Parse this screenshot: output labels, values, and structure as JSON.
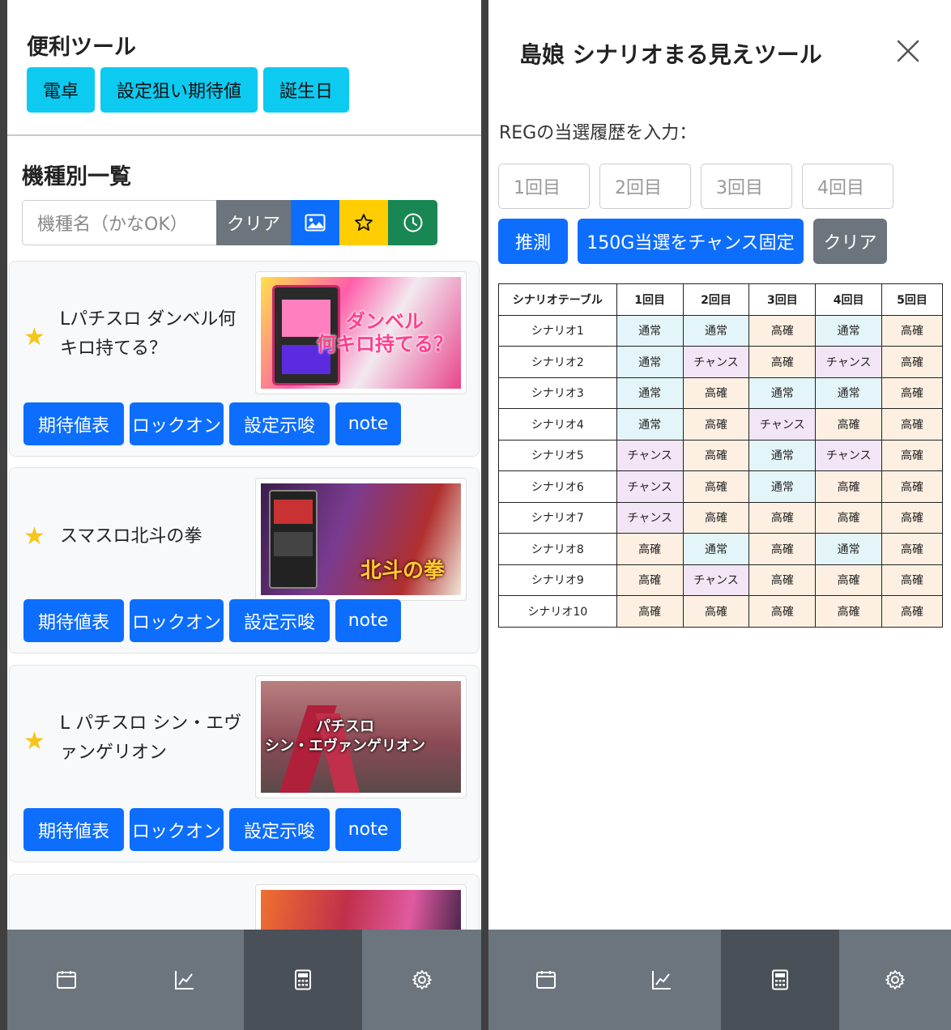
{
  "left": {
    "tools": {
      "title": "便利ツール",
      "buttons": [
        "電卓",
        "設定狙い期待値",
        "誕生日"
      ]
    },
    "models": {
      "title": "機種別一覧",
      "search_placeholder": "機種名（かなOK）",
      "clear_label": "クリア"
    },
    "cards": [
      {
        "title": "Lパチスロ ダンベル何キロ持てる？",
        "art_label": "ダンベル\n何キロ持てる？",
        "art_color": "#e8468c"
      },
      {
        "title": "スマスロ北斗の拳",
        "art_label": "北斗の拳",
        "art_color": "#7a3b8f"
      },
      {
        "title": "L パチスロ シン・エヴァンゲリオン",
        "art_label": "パチスロ\nシン・エヴァンゲリオン",
        "art_color": "#a0505a"
      },
      {
        "title": "",
        "art_label": "",
        "art_color": "#c0304a"
      }
    ],
    "card_buttons": [
      "期待値表",
      "ロックオン",
      "設定示唆",
      "note"
    ]
  },
  "right": {
    "title": "島娘 シナリオまる見えツール",
    "reg_label": "REGの当選履歴を入力：",
    "inputs": [
      "1回目",
      "2回目",
      "3回目",
      "4回目"
    ],
    "buttons": {
      "guess": "推測",
      "fix150": "150G当選をチャンス固定",
      "clear": "クリア"
    },
    "table": {
      "headers": [
        "シナリオテーブル",
        "1回目",
        "2回目",
        "3回目",
        "4回目",
        "5回目"
      ],
      "rows": [
        {
          "name": "シナリオ1",
          "cells": [
            "通常",
            "通常",
            "高確",
            "通常",
            "高確"
          ]
        },
        {
          "name": "シナリオ2",
          "cells": [
            "通常",
            "チャンス",
            "高確",
            "チャンス",
            "高確"
          ]
        },
        {
          "name": "シナリオ3",
          "cells": [
            "通常",
            "高確",
            "通常",
            "通常",
            "高確"
          ]
        },
        {
          "name": "シナリオ4",
          "cells": [
            "通常",
            "高確",
            "チャンス",
            "高確",
            "高確"
          ]
        },
        {
          "name": "シナリオ5",
          "cells": [
            "チャンス",
            "高確",
            "通常",
            "チャンス",
            "高確"
          ]
        },
        {
          "name": "シナリオ6",
          "cells": [
            "チャンス",
            "高確",
            "通常",
            "高確",
            "高確"
          ]
        },
        {
          "name": "シナリオ7",
          "cells": [
            "チャンス",
            "高確",
            "高確",
            "高確",
            "高確"
          ]
        },
        {
          "name": "シナリオ8",
          "cells": [
            "高確",
            "通常",
            "高確",
            "通常",
            "高確"
          ]
        },
        {
          "name": "シナリオ9",
          "cells": [
            "高確",
            "チャンス",
            "高確",
            "高確",
            "高確"
          ]
        },
        {
          "name": "シナリオ10",
          "cells": [
            "高確",
            "高確",
            "高確",
            "高確",
            "高確"
          ]
        }
      ]
    }
  },
  "nav": {
    "items": [
      "calendar-icon",
      "chart-line-icon",
      "calculator-icon",
      "gear-icon"
    ],
    "active_index": 2
  },
  "colors": {
    "primary": "#0d6efd",
    "info": "#0dcaf0",
    "secondary": "#6c757d",
    "warning": "#ffcd00",
    "success": "#198754",
    "nav_bg": "#6c757d",
    "nav_active": "#495057"
  }
}
